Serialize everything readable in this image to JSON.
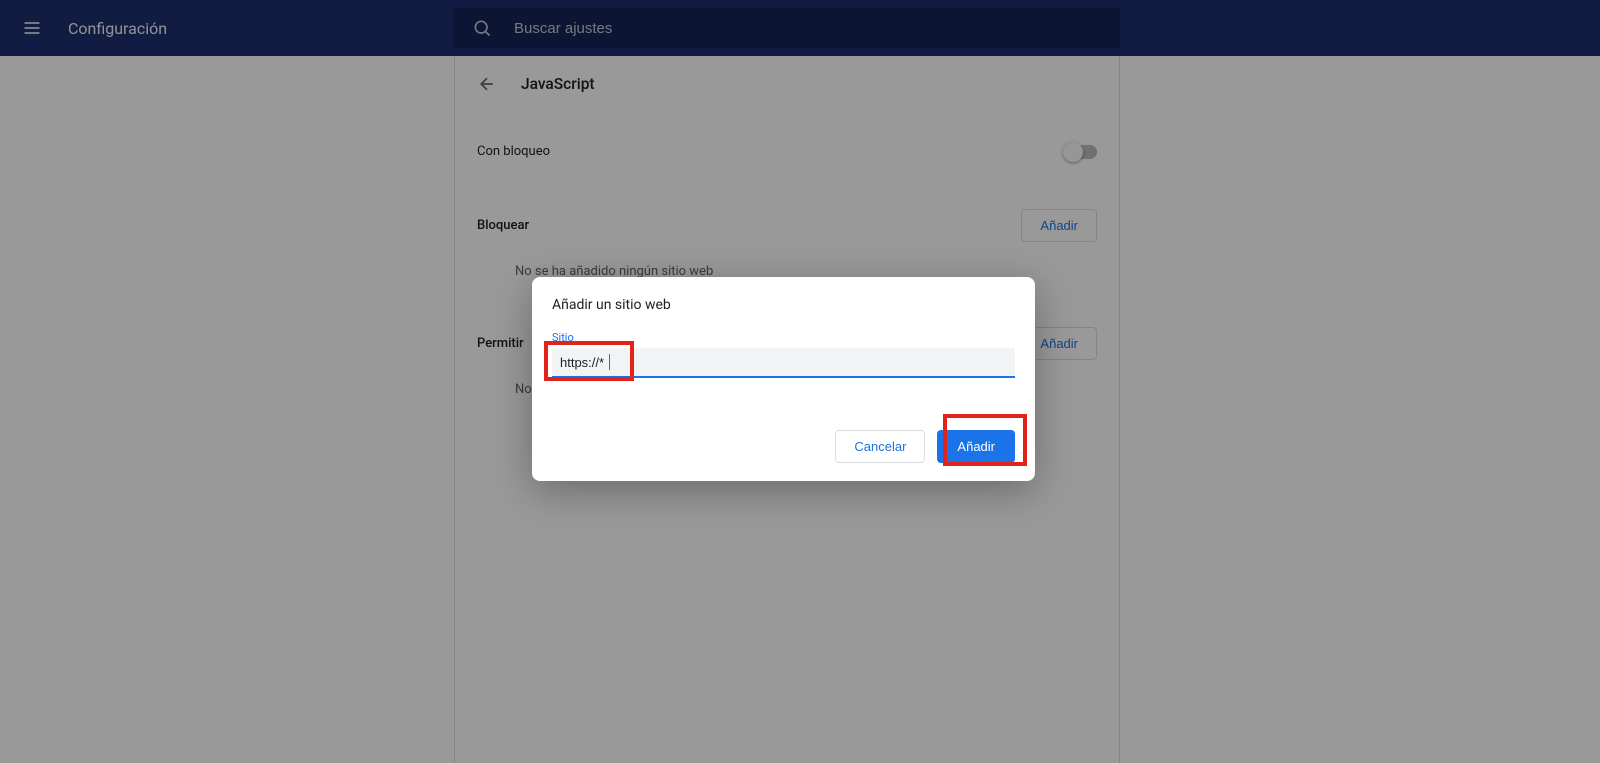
{
  "header": {
    "title": "Configuración",
    "search_placeholder": "Buscar ajustes"
  },
  "page": {
    "back_icon": "arrow-back",
    "title": "JavaScript",
    "toggle": {
      "label": "Con bloqueo",
      "enabled": false
    },
    "sections": [
      {
        "title": "Bloquear",
        "add_label": "Añadir",
        "empty_text": "No se ha añadido ningún sitio web"
      },
      {
        "title": "Permitir",
        "add_label": "Añadir",
        "empty_text": "No se ha añadido ningún sitio web"
      }
    ]
  },
  "dialog": {
    "title": "Añadir un sitio web",
    "field_label": "Sitio",
    "field_value": "https://*",
    "cancel_label": "Cancelar",
    "confirm_label": "Añadir"
  }
}
